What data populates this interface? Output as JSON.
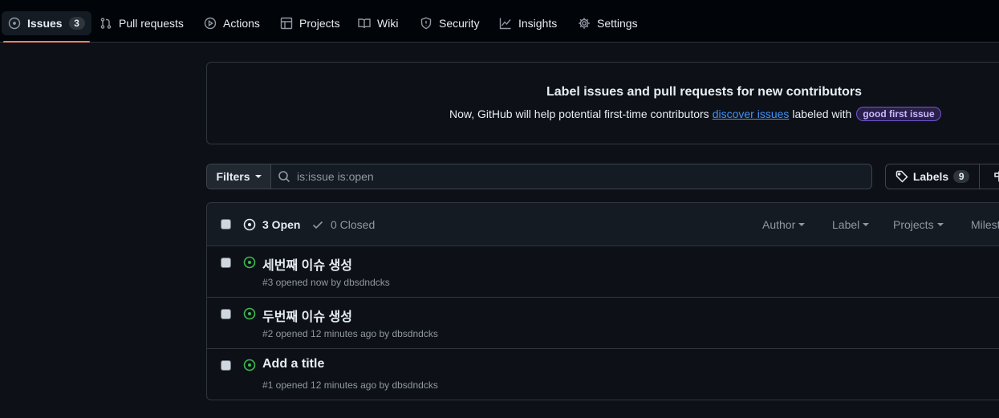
{
  "nav": {
    "items": [
      {
        "label": "Issues",
        "count": "3",
        "icon": "issue-opened-icon"
      },
      {
        "label": "Pull requests",
        "icon": "git-pull-request-icon"
      },
      {
        "label": "Actions",
        "icon": "play-icon"
      },
      {
        "label": "Projects",
        "icon": "table-icon"
      },
      {
        "label": "Wiki",
        "icon": "book-icon"
      },
      {
        "label": "Security",
        "icon": "shield-icon"
      },
      {
        "label": "Insights",
        "icon": "graph-icon"
      },
      {
        "label": "Settings",
        "icon": "gear-icon"
      }
    ]
  },
  "banner": {
    "title": "Label issues and pull requests for new contributors",
    "text_before": "Now, GitHub will help potential first-time contributors",
    "link": "discover issues",
    "text_after": "labeled with",
    "badge": "good first issue"
  },
  "filterbar": {
    "filters_label": "Filters",
    "search_value": "is:issue is:open",
    "labels_label": "Labels",
    "labels_count": "9"
  },
  "issues_header": {
    "open_label": "3 Open",
    "closed_label": "0 Closed",
    "filters": [
      "Author",
      "Label",
      "Projects",
      "Milestones"
    ]
  },
  "issues": [
    {
      "title": "세번째 이슈 생성",
      "meta": "#3 opened now by dbsdndcks"
    },
    {
      "title": "두번째 이슈 생성",
      "meta": "#2 opened 12 minutes ago by dbsdndcks"
    },
    {
      "title": "Add a title",
      "meta": "#1 opened 12 minutes ago by dbsdndcks"
    }
  ],
  "colors": {
    "accent_underline": "#f78166",
    "open_green": "#3fb950",
    "link_blue": "#4493f8"
  }
}
